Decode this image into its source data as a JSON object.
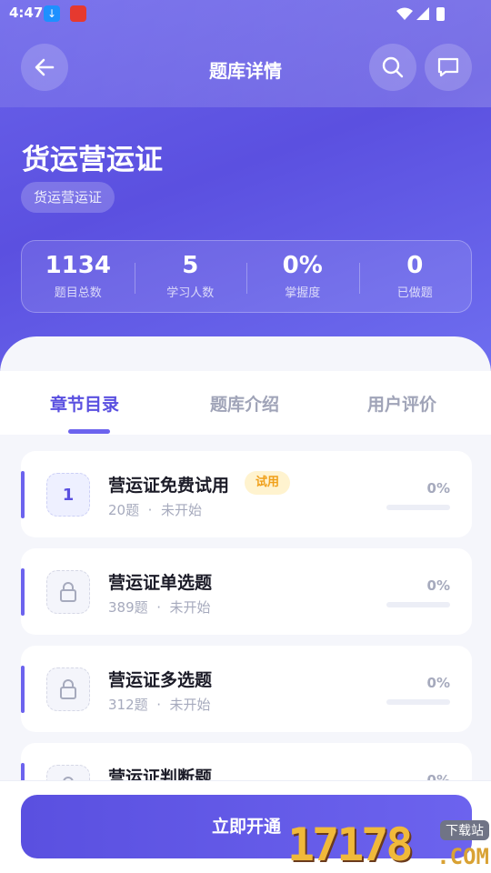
{
  "status_bar": {
    "time": "4:47"
  },
  "header": {
    "title": "题库详情"
  },
  "bank": {
    "title": "货运营运证",
    "tag": "货运营运证"
  },
  "stats": [
    {
      "value": "1134",
      "label": "题目总数"
    },
    {
      "value": "5",
      "label": "学习人数"
    },
    {
      "value": "0%",
      "label": "掌握度"
    },
    {
      "value": "0",
      "label": "已做题"
    }
  ],
  "tabs": [
    {
      "label": "章节目录",
      "active": true
    },
    {
      "label": "题库介绍",
      "active": false
    },
    {
      "label": "用户评价",
      "active": false
    }
  ],
  "chapters": [
    {
      "index": "1",
      "title": "营运证免费试用",
      "tag": "试用",
      "count": "20题",
      "status": "未开始",
      "progress": "0%",
      "locked": false
    },
    {
      "title": "营运证单选题",
      "count": "389题",
      "status": "未开始",
      "progress": "0%",
      "locked": true
    },
    {
      "title": "营运证多选题",
      "count": "312题",
      "status": "未开始",
      "progress": "0%",
      "locked": true
    },
    {
      "title": "营运证判断题",
      "progress": "0%",
      "locked": true
    }
  ],
  "footer": {
    "cta_label": "立即开通"
  },
  "watermark": {
    "digits": "17178",
    "site": "下载站",
    "domain": ".COM"
  },
  "colors": {
    "accent": "#5a50e0",
    "trial_tag": "#f0a01a"
  }
}
